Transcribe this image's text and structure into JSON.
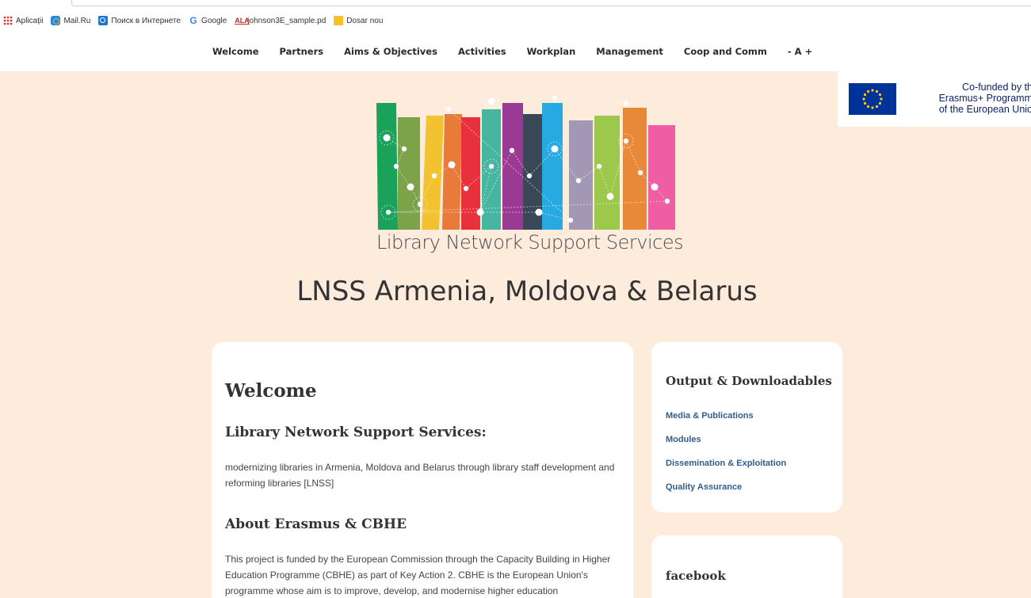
{
  "bookmarks": [
    {
      "label": "Aplicații",
      "icon": "apps-grid-icon"
    },
    {
      "label": "Mail.Ru",
      "icon": "mail-ru-icon"
    },
    {
      "label": "Поиск в Интернете",
      "icon": "search-icon"
    },
    {
      "label": "Google",
      "icon": "google-icon"
    },
    {
      "label": "johnson3E_sample.pd",
      "icon": "ala-icon"
    },
    {
      "label": "Dosar nou",
      "icon": "folder-icon"
    }
  ],
  "nav": {
    "items": [
      "Welcome",
      "Partners",
      "Aims & Objectives",
      "Activities",
      "Workplan",
      "Management",
      "Coop and Comm",
      "- A +"
    ]
  },
  "eu_badge": {
    "line1": "Co-funded by th",
    "line2": "Erasmus+ Programm",
    "line3": "of the European Unio"
  },
  "logo": {
    "text": "Library Network Support Services",
    "book_colors": [
      "#1aa15a",
      "#7ca24a",
      "#f2c230",
      "#e97b3a",
      "#e8313d",
      "#47b6a1",
      "#9b3a93",
      "#394756",
      "#27a9e1",
      "#a298b6",
      "#9cc84b",
      "#e8893a",
      "#ef5ea2"
    ]
  },
  "site_title": "LNSS Armenia, Moldova & Belarus",
  "main": {
    "heading": "Welcome",
    "subheading1": "Library Network Support Services:",
    "para1": "modernizing libraries in Armenia, Moldova and Belarus through library staff development and reforming libraries [LNSS]",
    "subheading2": "About Erasmus & CBHE",
    "para2": "This project is funded by the European Commission through the Capacity Building in Higher Education Programme (CBHE) as part of Key Action 2. CBHE is the European Union's programme whose aim is to improve, develop, and modernise higher education"
  },
  "sidebar": {
    "downloads_title": "Output & Downloadables",
    "links": [
      "Media & Publications",
      "Modules",
      "Dissemination & Exploitation",
      "Quality Assurance"
    ],
    "facebook_title": "facebook"
  },
  "colors": {
    "page_bg": "#fdebdc",
    "link": "#2f5d8f",
    "eu_blue": "#003399",
    "eu_yellow": "#ffcc00"
  }
}
